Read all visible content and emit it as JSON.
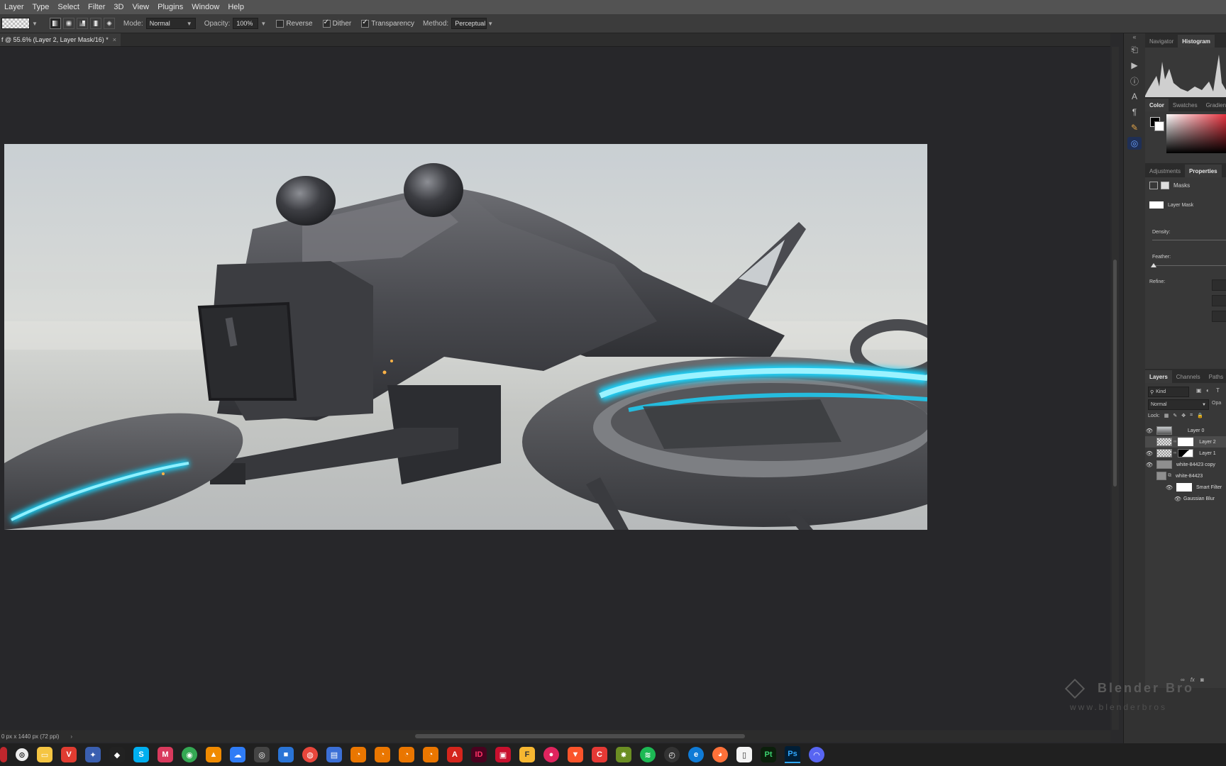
{
  "menubar": {
    "items": [
      "Layer",
      "Type",
      "Select",
      "Filter",
      "3D",
      "View",
      "Plugins",
      "Window",
      "Help"
    ]
  },
  "options": {
    "mode_label": "Mode:",
    "mode_value": "Normal",
    "opacity_label": "Opacity:",
    "opacity_value": "100%",
    "reverse_label": "Reverse",
    "reverse_checked": false,
    "dither_label": "Dither",
    "dither_checked": true,
    "transparency_label": "Transparency",
    "transparency_checked": true,
    "method_label": "Method:",
    "method_value": "Perceptual"
  },
  "document": {
    "tab_title": "f @ 55.6% (Layer 2, Layer Mask/16) *",
    "tab_close": "×",
    "status_text": "0 px x 1440 px (72 ppi)"
  },
  "panels": {
    "top_tabs": [
      "Navigator",
      "Histogram"
    ],
    "color_tabs": [
      "Color",
      "Swatches",
      "Gradients"
    ],
    "props_tabs": [
      "Adjustments",
      "Properties",
      "Li"
    ],
    "masks_label": "Masks",
    "layer_mask_label": "Layer Mask",
    "density_label": "Density:",
    "feather_label": "Feather:",
    "refine_label": "Refine:",
    "layers_tabs": [
      "Layers",
      "Channels",
      "Paths"
    ],
    "kind_label": "Kind",
    "blend_mode": "Normal",
    "opacity_short": "Opa",
    "lock_label": "Lock:",
    "layers": [
      {
        "name": "Layer 0",
        "visible": true
      },
      {
        "name": "Layer 2",
        "visible": false
      },
      {
        "name": "Layer 1",
        "visible": true
      },
      {
        "name": "white-84423 copy",
        "visible": true
      },
      {
        "name": "white-84423",
        "visible": false
      },
      {
        "name": "Smart Filter",
        "visible": true
      },
      {
        "name": "Gaussian Blur",
        "visible": true
      }
    ]
  },
  "watermark": {
    "brand": "Blender Bro",
    "url": "www.blenderbros"
  },
  "taskbar": {
    "apps": [
      "ID",
      "Pt",
      "Ps"
    ]
  },
  "colors": {
    "accent_cyan": "#19d6ff",
    "foreground": "#000000",
    "background": "#ffffff"
  }
}
